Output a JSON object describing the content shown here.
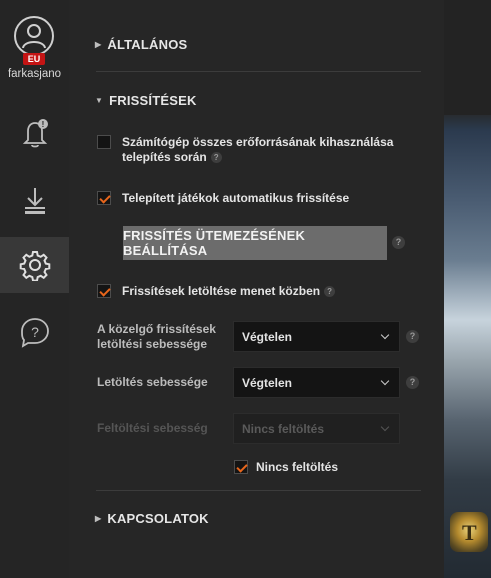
{
  "account": {
    "username": "farkasjano",
    "region_badge": "EU"
  },
  "sidebar": {
    "items": [
      {
        "icon": "bell-icon",
        "badge": "!"
      },
      {
        "icon": "download-icon"
      },
      {
        "icon": "gear-icon",
        "active": true
      },
      {
        "icon": "help-icon"
      }
    ]
  },
  "sections": {
    "general": {
      "title": "ÁLTALÁNOS"
    },
    "updates": {
      "title": "FRISSÍTÉSEK",
      "use_all_resources": {
        "label_line1": "Számítógép összes erőforrásának kihasználása",
        "label_line2": "telepítés során",
        "checked": false
      },
      "auto_update_installed": {
        "label": "Telepített játékok automatikus frissítése",
        "checked": true
      },
      "schedule_button": "FRISSÍTÉS ÜTEMEZÉSÉNEK BEÁLLÍTÁSA",
      "download_while_playing": {
        "label": "Frissítések letöltése menet közben",
        "checked": true
      },
      "upcoming_speed": {
        "label_line1": "A közelgő frissítések",
        "label_line2": "letöltési sebessége",
        "value": "Végtelen"
      },
      "download_speed": {
        "label": "Letöltés sebessége",
        "value": "Végtelen"
      },
      "upload_speed": {
        "label": "Feltöltési sebesség",
        "value": "Nincs feltöltés",
        "disabled": true
      },
      "no_upload": {
        "label": "Nincs feltöltés",
        "checked": true
      }
    },
    "connections": {
      "title": "KAPCSOLATOK"
    }
  },
  "help_glyph": "?",
  "colors": {
    "accent": "#e8661c",
    "eu_badge": "#c41414",
    "panel": "#262626",
    "sidebar": "#252525"
  }
}
